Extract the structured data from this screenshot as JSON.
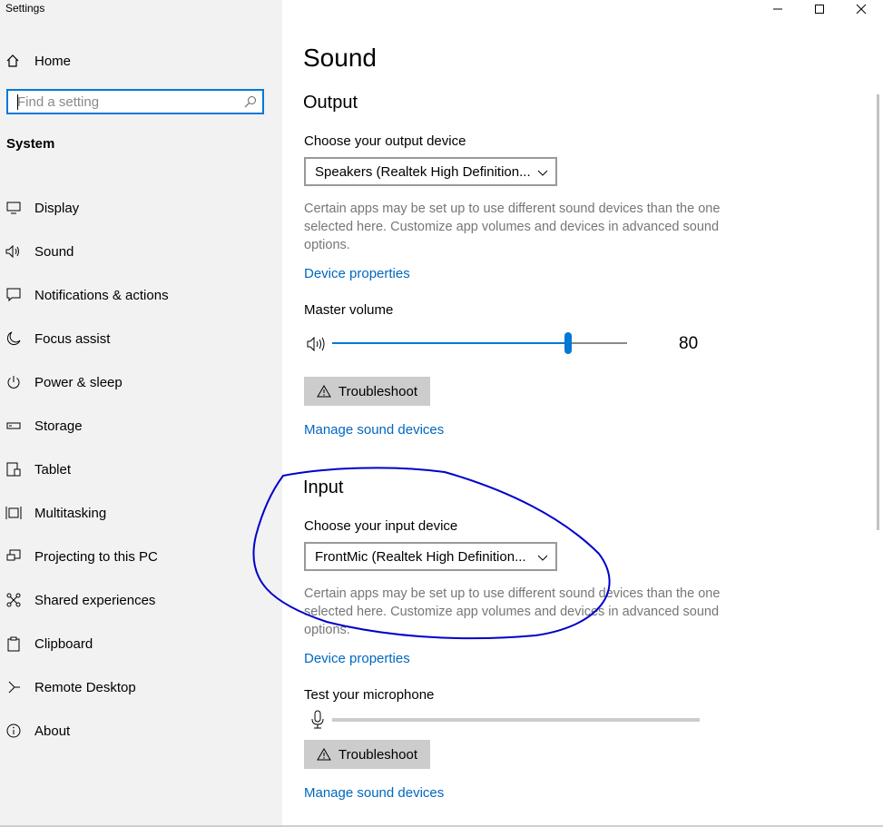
{
  "window": {
    "title": "Settings",
    "controls": [
      "minimize",
      "maximize",
      "close"
    ]
  },
  "sidebar": {
    "home_label": "Home",
    "search_placeholder": "Find a setting",
    "section_label": "System",
    "items": [
      {
        "label": "Display",
        "icon": "display-icon"
      },
      {
        "label": "Sound",
        "icon": "speaker-icon"
      },
      {
        "label": "Notifications & actions",
        "icon": "notifications-icon"
      },
      {
        "label": "Focus assist",
        "icon": "moon-icon"
      },
      {
        "label": "Power & sleep",
        "icon": "power-icon"
      },
      {
        "label": "Storage",
        "icon": "storage-icon"
      },
      {
        "label": "Tablet",
        "icon": "tablet-icon"
      },
      {
        "label": "Multitasking",
        "icon": "multitasking-icon"
      },
      {
        "label": "Projecting to this PC",
        "icon": "projecting-icon"
      },
      {
        "label": "Shared experiences",
        "icon": "shared-icon"
      },
      {
        "label": "Clipboard",
        "icon": "clipboard-icon"
      },
      {
        "label": "Remote Desktop",
        "icon": "remote-desktop-icon"
      },
      {
        "label": "About",
        "icon": "info-icon"
      }
    ]
  },
  "main": {
    "title": "Sound",
    "output": {
      "heading": "Output",
      "device_label": "Choose your output device",
      "device_value": "Speakers (Realtek High Definition...",
      "description": "Certain apps may be set up to use different sound devices than the one selected here. Customize app volumes and devices in advanced sound options.",
      "device_properties_link": "Device properties",
      "volume_label": "Master volume",
      "volume_value": "80",
      "volume_percent": 80,
      "troubleshoot_label": "Troubleshoot",
      "manage_link": "Manage sound devices"
    },
    "input": {
      "heading": "Input",
      "device_label": "Choose your input device",
      "device_value": "FrontMic (Realtek High Definition...",
      "description": "Certain apps may be set up to use different sound devices than the one selected here. Customize app volumes and devices in advanced sound options.",
      "device_properties_link": "Device properties",
      "test_label": "Test your microphone",
      "mic_level_percent": 0,
      "troubleshoot_label": "Troubleshoot",
      "manage_link": "Manage sound devices"
    }
  },
  "annotation": {
    "color": "#0000cc",
    "shape": "hand-drawn-ellipse"
  },
  "colors": {
    "accent": "#0078d7",
    "link": "#0067c0",
    "sidebar_bg": "#f2f2f2",
    "button_bg": "#cccccc"
  }
}
